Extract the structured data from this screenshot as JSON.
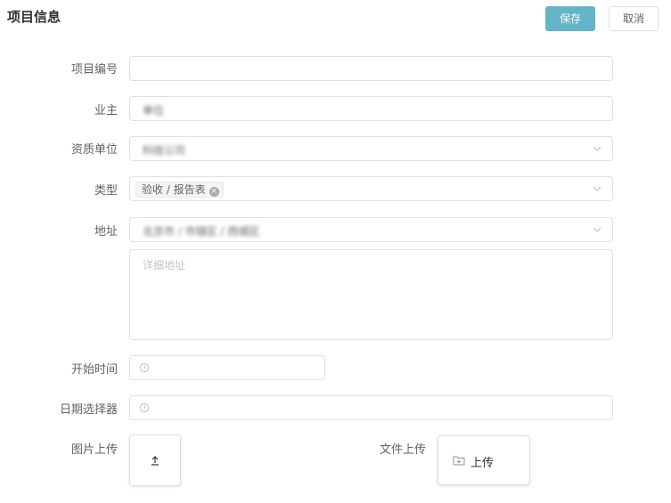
{
  "page": {
    "title": "项目信息"
  },
  "toolbar": {
    "save_label": "保存",
    "cancel_label": "取消"
  },
  "form": {
    "project_no": {
      "label": "项目编号",
      "value": ""
    },
    "owner": {
      "label": "业主",
      "value": "单位"
    },
    "qualification_unit": {
      "label": "资质单位",
      "value": "科技公司"
    },
    "type": {
      "label": "类型",
      "tag": "验收 / 报告表"
    },
    "address": {
      "label": "地址",
      "value": "北京市 / 市辖区 / 西城区",
      "detail_placeholder": "详细地址"
    },
    "start_time": {
      "label": "开始时间",
      "value": ""
    },
    "date_picker": {
      "label": "日期选择器",
      "value": ""
    },
    "image_upload": {
      "label": "图片上传"
    },
    "file_upload": {
      "label": "文件上传",
      "button_label": "上传"
    }
  },
  "icons": {
    "chevron": "chevron-down-icon",
    "clock": "clock-icon",
    "upload": "upload-arrow-icon",
    "folder": "folder-add-icon",
    "tag_close": "close-circle-icon"
  },
  "colors": {
    "primary": "#62b4c6",
    "border": "#dcdfe6",
    "label": "#606266",
    "placeholder": "#c0c4cc"
  }
}
